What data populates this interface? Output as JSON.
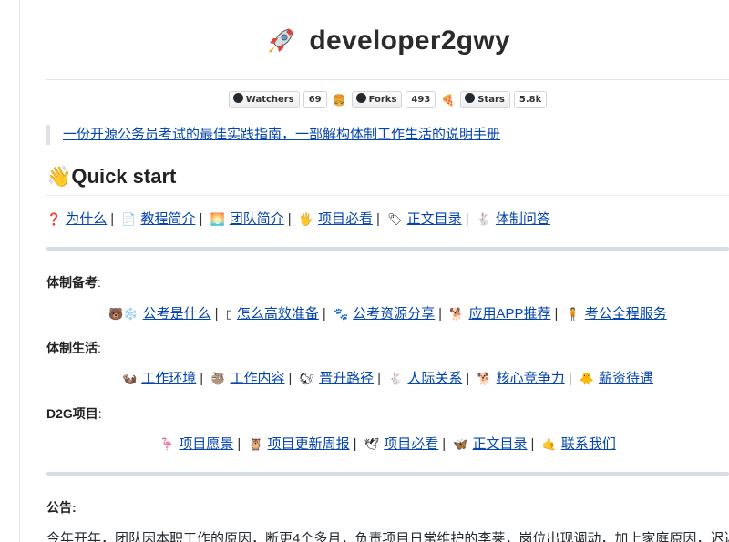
{
  "header": {
    "title": "developer2gwy",
    "title_icon": "rocket-icon"
  },
  "badges": [
    {
      "label": "Watchers",
      "count": "69",
      "after_emoji": "🍔"
    },
    {
      "label": "Forks",
      "count": "493",
      "after_emoji": "🍕"
    },
    {
      "label": "Stars",
      "count": "5.8k",
      "after_emoji": ""
    }
  ],
  "tagline": "一份开源公务员考试的最佳实践指南，一部解构体制工作生活的说明手册",
  "quick_start": {
    "emoji": "👋",
    "heading": "Quick start",
    "links": [
      {
        "emoji": "❓",
        "label": "为什么"
      },
      {
        "emoji": "📄",
        "label": "教程简介"
      },
      {
        "emoji": "🌅",
        "label": "团队简介"
      },
      {
        "emoji": "🖐",
        "label": "项目必看"
      },
      {
        "emoji": "🏷",
        "label": "正文目录"
      },
      {
        "emoji": "🐇",
        "label": "体制问答"
      }
    ]
  },
  "sections": [
    {
      "title": "体制备考",
      "suffix": ":",
      "links": [
        {
          "emoji": "🐻❄️",
          "label": "公考是什么"
        },
        {
          "emoji": "▯",
          "label": "怎么高效准备"
        },
        {
          "emoji": "🐾",
          "label": "公考资源分享"
        },
        {
          "emoji": "🐕",
          "label": "应用APP推荐"
        },
        {
          "emoji": "🧍",
          "label": "考公全程服务"
        }
      ]
    },
    {
      "title": "体制生活",
      "suffix": ":",
      "links": [
        {
          "emoji": "🦦",
          "label": "工作环境"
        },
        {
          "emoji": "🦥",
          "label": "工作内容"
        },
        {
          "emoji": "🐿",
          "label": "晋升路径"
        },
        {
          "emoji": "🐇",
          "label": "人际关系"
        },
        {
          "emoji": "🐕",
          "label": "核心竞争力"
        },
        {
          "emoji": "🐥",
          "label": "薪资待遇"
        }
      ]
    },
    {
      "title": "D2G项目",
      "suffix": ":",
      "links": [
        {
          "emoji": "🦩",
          "label": "项目愿景"
        },
        {
          "emoji": "🦉",
          "label": "项目更新周报"
        },
        {
          "emoji": "🕊",
          "label": "项目必看"
        },
        {
          "emoji": "🦋",
          "label": "正文目录"
        },
        {
          "emoji": "🤙",
          "label": "联系我们"
        }
      ]
    }
  ],
  "notice": {
    "title": "公告",
    "suffix": ":",
    "text": "今年开年，团队因本职工作的原因，断更4个多月，负责项目日常维护的李莱，岗位出现调动，加上家庭原因，迟迟没"
  },
  "colors": {
    "link": "#0645ad",
    "rule": "#d7dde3",
    "text": "#24292e"
  }
}
